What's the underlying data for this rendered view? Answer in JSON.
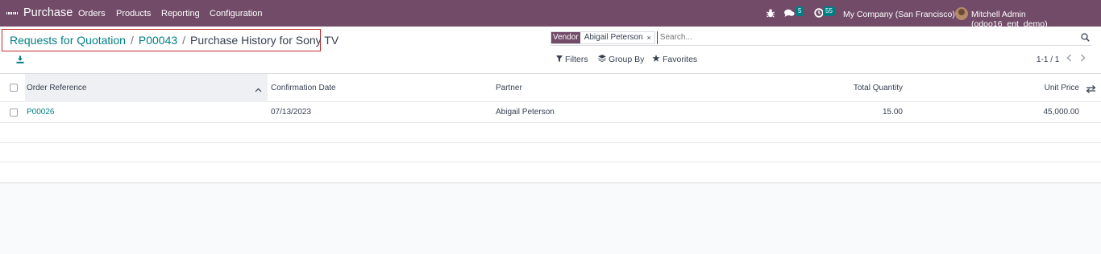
{
  "navbar": {
    "app_name": "Purchase",
    "menu": [
      "Orders",
      "Products",
      "Reporting",
      "Configuration"
    ],
    "chat_count": "5",
    "activity_count": "55",
    "company": "My Company (San Francisco)",
    "user": "Mitchell Admin (odoo16_ent_demo)",
    "color": "#714b67"
  },
  "breadcrumb": {
    "items": [
      "Requests for Quotation",
      "P00043"
    ],
    "current": "Purchase History for Sony TV",
    "separator": "/"
  },
  "search": {
    "facet_label": "Vendor",
    "facet_value": "Abigail Peterson",
    "facet_remove": "×",
    "placeholder": "Search..."
  },
  "filters": {
    "filters_label": "Filters",
    "group_by_label": "Group By",
    "favorites_label": "Favorites"
  },
  "pager": {
    "value": "1-1 / 1"
  },
  "table": {
    "columns": [
      "Order Reference",
      "Confirmation Date",
      "Partner",
      "Total Quantity",
      "Unit Price"
    ],
    "rows": [
      {
        "order_reference": "P00026",
        "confirmation_date": "07/13/2023",
        "partner": "Abigail Peterson",
        "total_quantity": "15.00",
        "unit_price": "45,000.00"
      }
    ]
  },
  "colors": {
    "accent": "#017e84",
    "brand": "#714b67"
  },
  "icons": [
    "apps-grid-icon",
    "bug-icon",
    "chat-icon",
    "clock-icon",
    "download-icon",
    "search-icon",
    "filter-icon",
    "layers-icon",
    "star-icon",
    "sort-up-icon",
    "column-settings-icon",
    "chevron-left-icon",
    "chevron-right-icon"
  ]
}
